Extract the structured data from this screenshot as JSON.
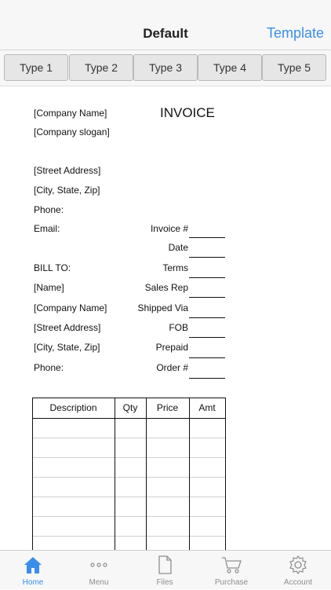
{
  "nav": {
    "title": "Default",
    "right_button": "Template"
  },
  "types": [
    "Type 1",
    "Type 2",
    "Type 3",
    "Type 4",
    "Type 5"
  ],
  "invoice": {
    "title": "INVOICE",
    "company_name": "[Company Name]",
    "company_slogan": "[Company slogan]",
    "street_address": "[Street Address]",
    "city_state_zip": "[City, State,  Zip]",
    "phone": "Phone:",
    "email": "Email:",
    "fields": [
      "Invoice #",
      "Date",
      "Terms",
      "Sales Rep",
      "Shipped Via",
      "FOB",
      "Prepaid",
      "Order #"
    ],
    "bill_to": {
      "label": "BILL TO:",
      "name": "[Name]",
      "company_name": "[Company Name]",
      "street_address": "[Street Address]",
      "city_state_zip": "[City, State,  Zip]",
      "phone": "Phone:"
    },
    "table_headers": [
      "Description",
      "Qty",
      "Price",
      "Amt"
    ]
  },
  "tabs": [
    {
      "label": "Home",
      "icon": "home-icon",
      "active": true
    },
    {
      "label": "Menu",
      "icon": "more-dots-icon",
      "active": false
    },
    {
      "label": "Files",
      "icon": "document-icon",
      "active": false
    },
    {
      "label": "Purchase",
      "icon": "cart-icon",
      "active": false
    },
    {
      "label": "Account",
      "icon": "gear-icon",
      "active": false
    }
  ],
  "colors": {
    "accent": "#3b8ee8",
    "bar_bg": "#f7f7f7",
    "tab_inactive": "#8e8e8e"
  }
}
